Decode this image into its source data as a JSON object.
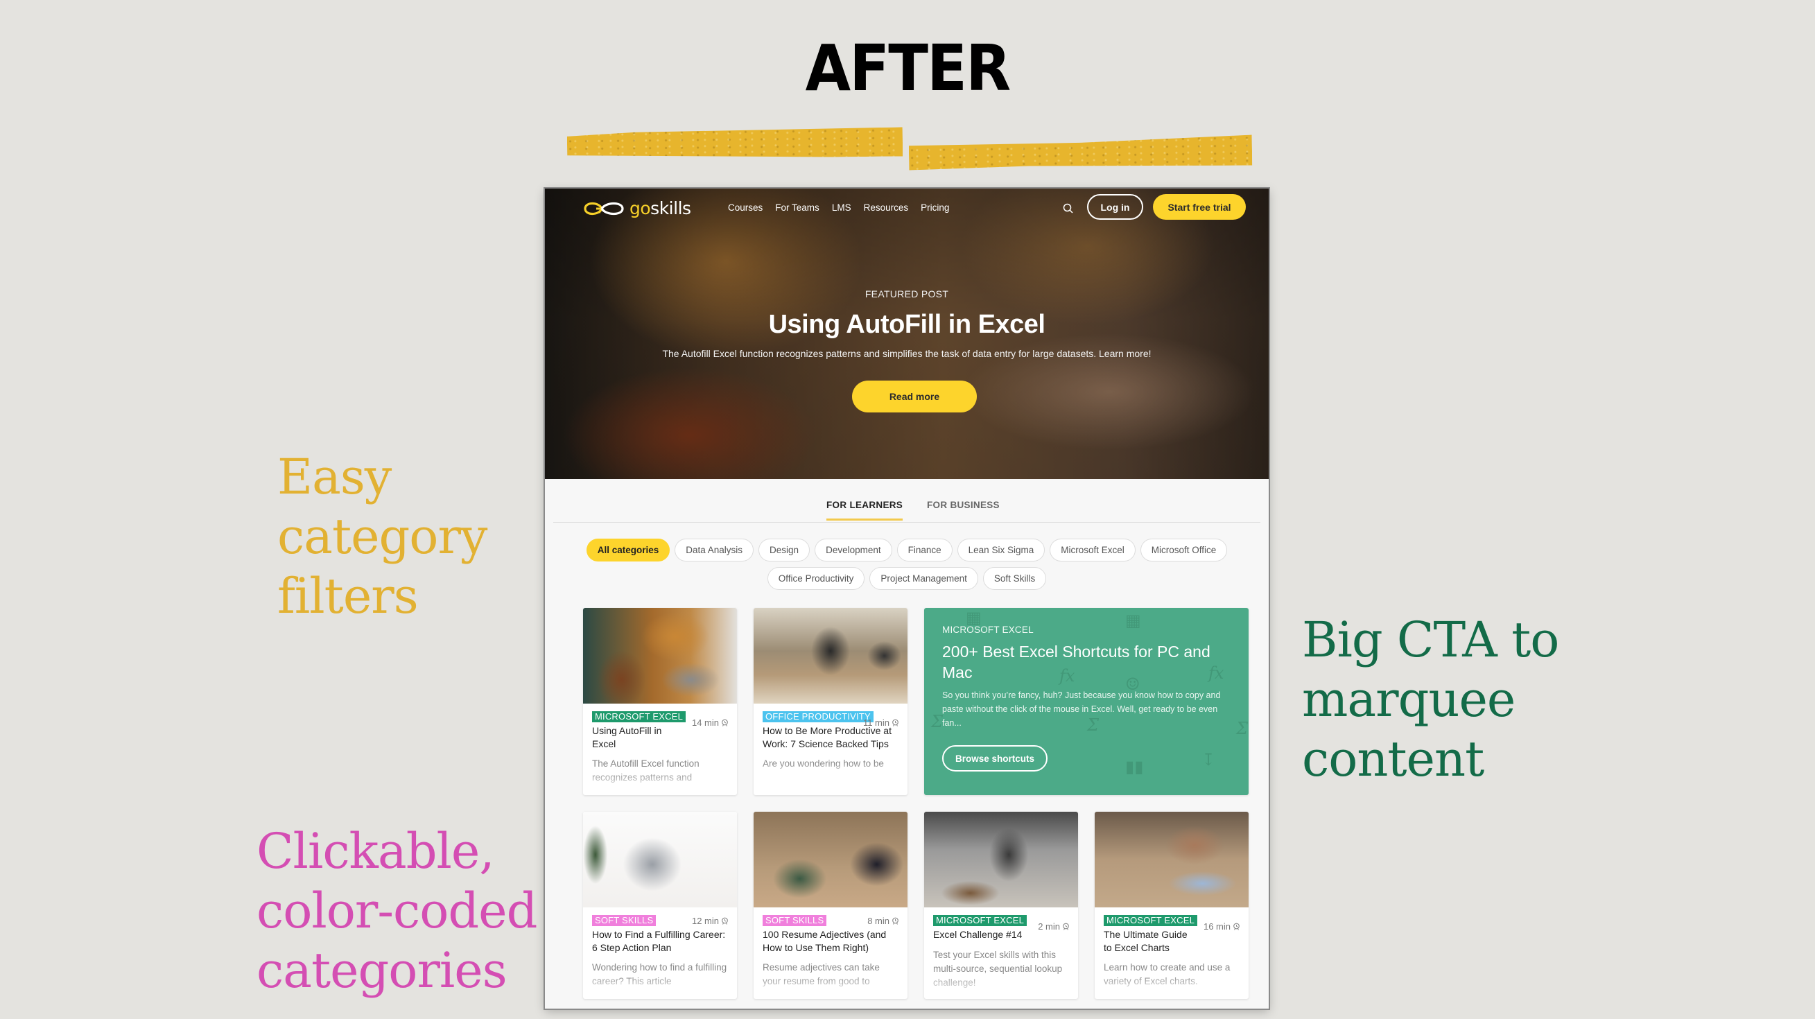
{
  "slide": {
    "title": "AFTER",
    "annotations": {
      "filters": [
        "Easy",
        "category",
        "filters"
      ],
      "categories": [
        "Clickable,",
        "color-coded",
        "categories"
      ],
      "cta": [
        "Big CTA to",
        "marquee",
        "content"
      ]
    },
    "colors": {
      "background": "#e4e3df",
      "tape": "#e7b52d",
      "filters_annotation": "#e2b132",
      "categories_annotation": "#d44eb3",
      "cta_annotation": "#136b48"
    }
  },
  "site": {
    "logo": {
      "icon": "infinity-go-icon",
      "go": "go",
      "skills": "skills"
    },
    "nav": {
      "links": [
        "Courses",
        "For Teams",
        "LMS",
        "Resources",
        "Pricing"
      ],
      "search_icon": "search-icon",
      "login_label": "Log in",
      "trial_label": "Start free trial"
    },
    "hero": {
      "eyebrow": "FEATURED POST",
      "title": "Using AutoFill in Excel",
      "description": "The Autofill Excel function recognizes patterns and simplifies the task of data entry for large datasets. Learn more!",
      "button_label": "Read more"
    },
    "tabs": [
      {
        "label": "FOR LEARNERS",
        "active": true
      },
      {
        "label": "FOR BUSINESS",
        "active": false
      }
    ],
    "categories": {
      "row1": [
        "All categories",
        "Data Analysis",
        "Design",
        "Development",
        "Finance",
        "Lean Six Sigma",
        "Microsoft Excel",
        "Microsoft Office"
      ],
      "row2": [
        "Office Productivity",
        "Project Management",
        "Soft Skills"
      ],
      "selected": "All categories"
    },
    "category_colors": {
      "MICROSOFT EXCEL": "#1e9a6c",
      "OFFICE PRODUCTIVITY": "#4cc3ee",
      "SOFT SKILLS": "#f07fdc"
    },
    "cards": [
      {
        "category": "MICROSOFT EXCEL",
        "time": "14 min",
        "title": "Using AutoFill in Excel",
        "excerpt": "The Autofill Excel function recognizes patterns and"
      },
      {
        "category": "OFFICE PRODUCTIVITY",
        "time": "11 min",
        "title": "How to Be More Productive at Work: 7 Science Backed Tips",
        "excerpt": "Are you wondering how to be"
      },
      {
        "category": "SOFT SKILLS",
        "time": "12 min",
        "title": "How to Find a Fulfilling Career: 6 Step Action Plan",
        "excerpt": "Wondering how to find a fulfilling career? This article"
      },
      {
        "category": "SOFT SKILLS",
        "time": "8 min",
        "title": "100 Resume Adjectives (and How to Use Them Right)",
        "excerpt": "Resume adjectives can take your resume from good to"
      },
      {
        "category": "MICROSOFT EXCEL",
        "time": "2 min",
        "title": "Excel Challenge #14",
        "excerpt": "Test your Excel skills with this multi-source, sequential lookup challenge!"
      },
      {
        "category": "MICROSOFT EXCEL",
        "time": "16 min",
        "title": "The Ultimate Guide to Excel Charts",
        "excerpt": "Learn how to create and use a variety of Excel charts."
      }
    ],
    "cta": {
      "eyebrow": "MICROSOFT EXCEL",
      "title": "200+ Best Excel Shortcuts for PC and Mac",
      "description": "So you think you’re fancy, huh? Just because you know how to copy and paste without the click of the mouse in Excel. Well, get ready to be even fan...",
      "button_label": "Browse shortcuts",
      "color": "#4caa88"
    },
    "accent_color": "#fdd42c"
  }
}
